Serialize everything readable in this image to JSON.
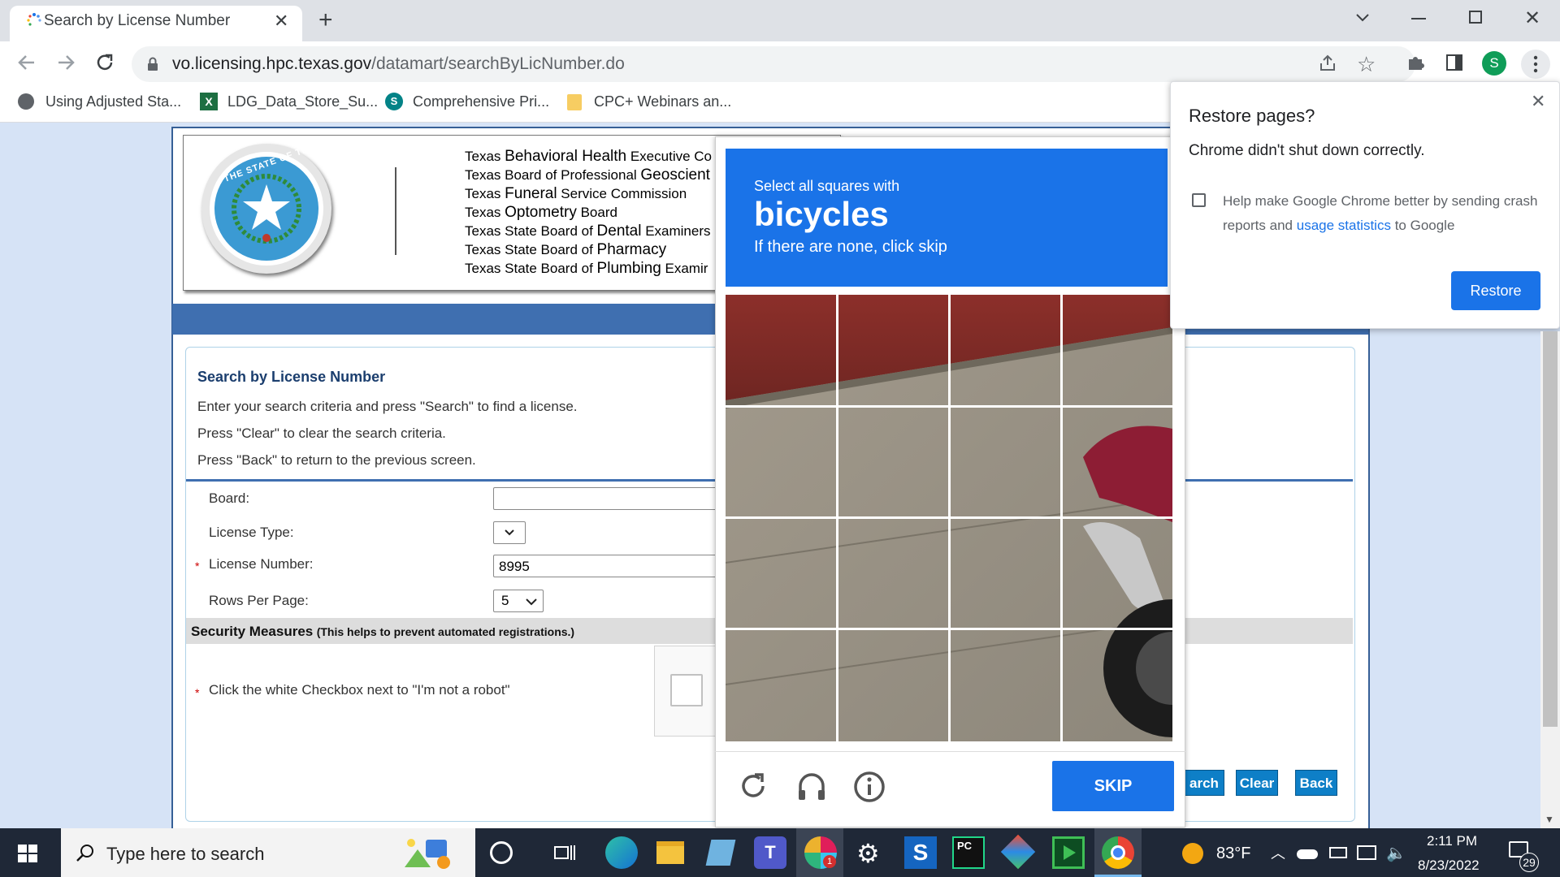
{
  "browser": {
    "tab_title": "Search by License Number",
    "url_host": "vo.licensing.hpc.texas.gov",
    "url_path": "/datamart/searchByLicNumber.do",
    "bookmarks": [
      "Using Adjusted Sta...",
      "LDG_Data_Store_Su...",
      "Comprehensive Pri...",
      "CPC+ Webinars an..."
    ],
    "profile_initial": "S"
  },
  "header": {
    "seal_text": "THE STATE OF TEXAS",
    "boards": [
      {
        "pre": "Texas ",
        "big": "Behavioral Health",
        "post": " Executive Co"
      },
      {
        "pre": "Texas Board of Professional ",
        "big": "Geoscient",
        "post": ""
      },
      {
        "pre": "Texas ",
        "big": "Funeral",
        "post": " Service Commission"
      },
      {
        "pre": "Texas ",
        "big": "Optometry",
        "post": " Board"
      },
      {
        "pre": "Texas State Board of ",
        "big": "Dental",
        "post": " Examiners"
      },
      {
        "pre": "Texas State Board of ",
        "big": "Pharmacy",
        "post": ""
      },
      {
        "pre": "Texas State Board of ",
        "big": "Plumbing",
        "post": " Examir"
      }
    ]
  },
  "form": {
    "title": "Search by License Number",
    "instructions": [
      "Enter your search criteria and press \"Search\" to find a license.",
      "Press \"Clear\" to clear the search criteria.",
      "Press \"Back\" to return to the previous screen."
    ],
    "board_label": "Board:",
    "board_value": "",
    "license_type_label": "License Type:",
    "license_type_value": "",
    "license_number_label": "License Number:",
    "license_number_value": "8995",
    "rows_label": "Rows Per Page:",
    "rows_value": "5",
    "required_mark": "*",
    "security_title": "Security Measures",
    "security_note": "(This helps to prevent automated registrations.)",
    "checkbox_instruction": "Click the white Checkbox next to \"I'm not a robot\"",
    "search_button": "arch",
    "clear_button": "Clear",
    "back_button": "Back"
  },
  "captcha": {
    "prompt": "Select all squares with",
    "target": "bicycles",
    "hint": "If there are none, click skip",
    "skip_button": "SKIP",
    "tiles": [
      "wall",
      "wall",
      "wall",
      "wall",
      "pavement",
      "pavement",
      "pavement",
      "motorcycle-fender",
      "pavement",
      "pavement",
      "pavement",
      "motorcycle-exhaust",
      "pavement",
      "pavement",
      "pavement",
      "motorcycle-wheel"
    ]
  },
  "restore_dialog": {
    "title": "Restore pages?",
    "message": "Chrome didn't shut down correctly.",
    "checkbox_pre": "Help make Google Chrome better by sending crash reports and ",
    "checkbox_link": "usage statistics",
    "checkbox_post": " to Google",
    "restore_button": "Restore"
  },
  "taskbar": {
    "search_placeholder": "Type here to search",
    "weather": "83°F",
    "time": "2:11 PM",
    "date": "8/23/2022",
    "notification_count": "29",
    "slack_badge": "1"
  },
  "colors": {
    "accent": "#1a73e8",
    "header_blue": "#3f6fb0",
    "page_bg": "#d6e3f6",
    "taskbar": "#1f2837"
  }
}
